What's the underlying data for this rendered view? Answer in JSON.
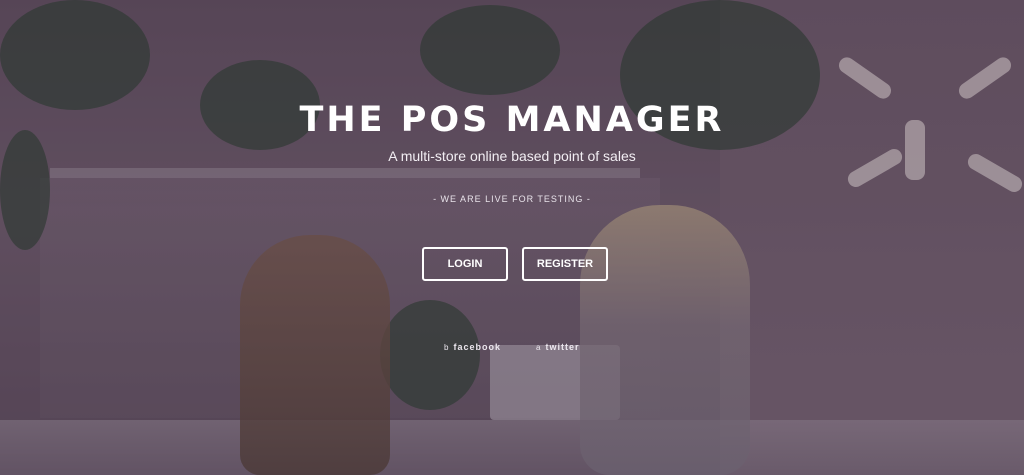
{
  "hero": {
    "title": "THE POS MANAGER",
    "subtitle": "A multi-store online based point of sales",
    "tagline": "- WE ARE LIVE FOR TESTING -"
  },
  "buttons": {
    "login_label": "LOGIN",
    "register_label": "REGISTER"
  },
  "social": {
    "facebook": {
      "icon": "b",
      "label": "facebook"
    },
    "twitter": {
      "icon": "a",
      "label": "twitter"
    }
  },
  "colors": {
    "text": "#ffffff",
    "overlay": "#28192d"
  }
}
